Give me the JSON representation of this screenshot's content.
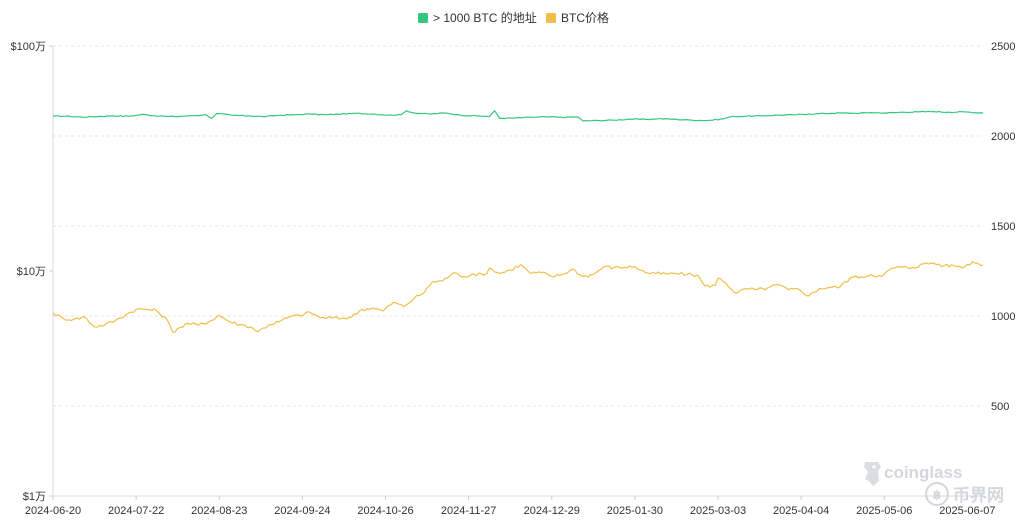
{
  "chart_data": {
    "type": "line",
    "title": "",
    "legend_position": "top-center",
    "grid": true,
    "x_type": "date",
    "xticks": [
      "2024-06-20",
      "2024-07-22",
      "2024-08-23",
      "2024-09-24",
      "2024-10-26",
      "2024-11-27",
      "2024-12-29",
      "2025-01-30",
      "2025-03-03",
      "2025-04-04",
      "2025-05-06",
      "2025-06-07"
    ],
    "xlim": [
      "2024-06-20",
      "2025-06-13"
    ],
    "y_left": {
      "scale": "log",
      "lim": [
        10000,
        1000000
      ],
      "ticks": [
        10000,
        100000,
        1000000
      ],
      "tick_labels": [
        "$1万",
        "$10万",
        "$100万"
      ]
    },
    "y_right": {
      "scale": "linear",
      "lim": [
        0,
        2500
      ],
      "ticks": [
        500,
        1000,
        1500,
        2000,
        2500
      ],
      "tick_labels": [
        "500",
        "1000",
        "1500",
        "2000",
        "2500"
      ]
    },
    "series": [
      {
        "name": "> 1000 BTC 的地址",
        "axis": "right",
        "color": "#34c77b",
        "points": [
          [
            "2024-06-20",
            2110
          ],
          [
            "2024-06-25",
            2110
          ],
          [
            "2024-07-01",
            2105
          ],
          [
            "2024-07-07",
            2108
          ],
          [
            "2024-07-13",
            2112
          ],
          [
            "2024-07-19",
            2110
          ],
          [
            "2024-07-25",
            2120
          ],
          [
            "2024-07-31",
            2110
          ],
          [
            "2024-08-06",
            2108
          ],
          [
            "2024-08-12",
            2112
          ],
          [
            "2024-08-18",
            2118
          ],
          [
            "2024-08-20",
            2098
          ],
          [
            "2024-08-22",
            2125
          ],
          [
            "2024-08-28",
            2115
          ],
          [
            "2024-09-03",
            2112
          ],
          [
            "2024-09-09",
            2108
          ],
          [
            "2024-09-15",
            2115
          ],
          [
            "2024-09-21",
            2118
          ],
          [
            "2024-09-27",
            2122
          ],
          [
            "2024-10-03",
            2118
          ],
          [
            "2024-10-09",
            2122
          ],
          [
            "2024-10-15",
            2126
          ],
          [
            "2024-10-21",
            2122
          ],
          [
            "2024-10-27",
            2116
          ],
          [
            "2024-11-01",
            2118
          ],
          [
            "2024-11-03",
            2140
          ],
          [
            "2024-11-06",
            2128
          ],
          [
            "2024-11-12",
            2122
          ],
          [
            "2024-11-18",
            2128
          ],
          [
            "2024-11-24",
            2115
          ],
          [
            "2024-11-30",
            2112
          ],
          [
            "2024-12-05",
            2108
          ],
          [
            "2024-12-07",
            2140
          ],
          [
            "2024-12-09",
            2098
          ],
          [
            "2024-12-15",
            2100
          ],
          [
            "2024-12-21",
            2104
          ],
          [
            "2024-12-27",
            2106
          ],
          [
            "2025-01-02",
            2104
          ],
          [
            "2025-01-08",
            2106
          ],
          [
            "2025-01-10",
            2084
          ],
          [
            "2025-01-16",
            2086
          ],
          [
            "2025-01-22",
            2088
          ],
          [
            "2025-01-28",
            2094
          ],
          [
            "2025-02-03",
            2092
          ],
          [
            "2025-02-09",
            2096
          ],
          [
            "2025-02-15",
            2092
          ],
          [
            "2025-02-21",
            2088
          ],
          [
            "2025-02-27",
            2086
          ],
          [
            "2025-03-05",
            2095
          ],
          [
            "2025-03-08",
            2108
          ],
          [
            "2025-03-14",
            2110
          ],
          [
            "2025-03-20",
            2112
          ],
          [
            "2025-03-26",
            2116
          ],
          [
            "2025-04-01",
            2118
          ],
          [
            "2025-04-07",
            2122
          ],
          [
            "2025-04-13",
            2125
          ],
          [
            "2025-04-19",
            2128
          ],
          [
            "2025-04-25",
            2126
          ],
          [
            "2025-05-01",
            2130
          ],
          [
            "2025-05-07",
            2128
          ],
          [
            "2025-05-13",
            2132
          ],
          [
            "2025-05-19",
            2134
          ],
          [
            "2025-05-25",
            2136
          ],
          [
            "2025-05-31",
            2132
          ],
          [
            "2025-06-06",
            2134
          ],
          [
            "2025-06-13",
            2128
          ]
        ]
      },
      {
        "name": "BTC价格",
        "axis": "left",
        "color": "#f0be4b",
        "points": [
          [
            "2024-06-20",
            65000
          ],
          [
            "2024-06-24",
            61500
          ],
          [
            "2024-06-28",
            61000
          ],
          [
            "2024-07-02",
            62500
          ],
          [
            "2024-07-06",
            56500
          ],
          [
            "2024-07-10",
            57800
          ],
          [
            "2024-07-14",
            60200
          ],
          [
            "2024-07-18",
            64000
          ],
          [
            "2024-07-22",
            67500
          ],
          [
            "2024-07-26",
            67600
          ],
          [
            "2024-07-30",
            66500
          ],
          [
            "2024-08-03",
            60500
          ],
          [
            "2024-08-05",
            53500
          ],
          [
            "2024-08-07",
            55500
          ],
          [
            "2024-08-11",
            58500
          ],
          [
            "2024-08-15",
            57500
          ],
          [
            "2024-08-19",
            59500
          ],
          [
            "2024-08-23",
            63500
          ],
          [
            "2024-08-27",
            59500
          ],
          [
            "2024-08-31",
            57800
          ],
          [
            "2024-09-04",
            56500
          ],
          [
            "2024-09-07",
            53800
          ],
          [
            "2024-09-11",
            57500
          ],
          [
            "2024-09-15",
            59500
          ],
          [
            "2024-09-19",
            62500
          ],
          [
            "2024-09-23",
            63500
          ],
          [
            "2024-09-27",
            65500
          ],
          [
            "2024-10-01",
            62000
          ],
          [
            "2024-10-05",
            62000
          ],
          [
            "2024-10-09",
            61500
          ],
          [
            "2024-10-13",
            62500
          ],
          [
            "2024-10-17",
            67500
          ],
          [
            "2024-10-21",
            68500
          ],
          [
            "2024-10-25",
            66500
          ],
          [
            "2024-10-29",
            72500
          ],
          [
            "2024-11-02",
            69500
          ],
          [
            "2024-11-06",
            75500
          ],
          [
            "2024-11-10",
            80500
          ],
          [
            "2024-11-13",
            89500
          ],
          [
            "2024-11-17",
            90500
          ],
          [
            "2024-11-21",
            98000
          ],
          [
            "2024-11-25",
            94500
          ],
          [
            "2024-11-29",
            97000
          ],
          [
            "2024-12-03",
            96000
          ],
          [
            "2024-12-05",
            103000
          ],
          [
            "2024-12-09",
            97500
          ],
          [
            "2024-12-13",
            101000
          ],
          [
            "2024-12-17",
            106500
          ],
          [
            "2024-12-21",
            97500
          ],
          [
            "2024-12-25",
            98500
          ],
          [
            "2024-12-29",
            94500
          ],
          [
            "2025-01-02",
            96500
          ],
          [
            "2025-01-06",
            102000
          ],
          [
            "2025-01-10",
            94500
          ],
          [
            "2025-01-14",
            96500
          ],
          [
            "2025-01-18",
            104500
          ],
          [
            "2025-01-22",
            103500
          ],
          [
            "2025-01-26",
            104000
          ],
          [
            "2025-01-30",
            104500
          ],
          [
            "2025-02-03",
            98500
          ],
          [
            "2025-02-07",
            97500
          ],
          [
            "2025-02-11",
            97000
          ],
          [
            "2025-02-15",
            97500
          ],
          [
            "2025-02-19",
            96500
          ],
          [
            "2025-02-23",
            96000
          ],
          [
            "2025-02-26",
            85500
          ],
          [
            "2025-03-02",
            86500
          ],
          [
            "2025-03-03",
            93000
          ],
          [
            "2025-03-06",
            88500
          ],
          [
            "2025-03-10",
            79500
          ],
          [
            "2025-03-14",
            83500
          ],
          [
            "2025-03-18",
            82500
          ],
          [
            "2025-03-22",
            84000
          ],
          [
            "2025-03-26",
            87000
          ],
          [
            "2025-03-30",
            82500
          ],
          [
            "2025-04-03",
            83000
          ],
          [
            "2025-04-07",
            77500
          ],
          [
            "2025-04-11",
            83500
          ],
          [
            "2025-04-15",
            84500
          ],
          [
            "2025-04-19",
            85000
          ],
          [
            "2025-04-23",
            93500
          ],
          [
            "2025-04-27",
            94000
          ],
          [
            "2025-05-01",
            96500
          ],
          [
            "2025-05-05",
            94500
          ],
          [
            "2025-05-09",
            103000
          ],
          [
            "2025-05-13",
            104000
          ],
          [
            "2025-05-17",
            103500
          ],
          [
            "2025-05-21",
            107500
          ],
          [
            "2025-05-25",
            108500
          ],
          [
            "2025-05-29",
            105500
          ],
          [
            "2025-06-02",
            105500
          ],
          [
            "2025-06-06",
            104500
          ],
          [
            "2025-06-09",
            110000
          ],
          [
            "2025-06-13",
            106000
          ]
        ]
      }
    ]
  },
  "watermarks": {
    "brand": "coinglass",
    "site": "币界网"
  }
}
